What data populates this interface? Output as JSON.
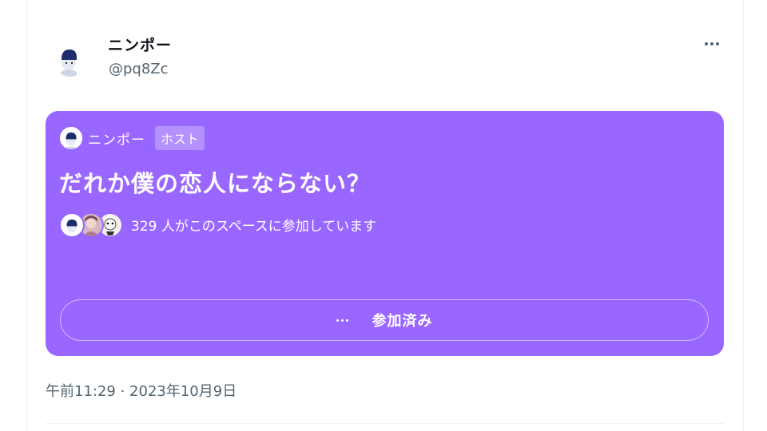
{
  "tweet": {
    "author_name": "ニンポー",
    "author_handle": "@pq8Zc",
    "more_icon": "ellipsis-icon",
    "timestamp": "午前11:29 · 2023年10月9日"
  },
  "space": {
    "background_color": "#9966ff",
    "host_name": "ニンポー",
    "host_badge": "ホスト",
    "title": "だれか僕の恋人にならない？",
    "listeners_text": "329 人がこのスペースに参加しています",
    "joined_label": "参加済み",
    "joined_icon": "ellipsis-icon"
  }
}
